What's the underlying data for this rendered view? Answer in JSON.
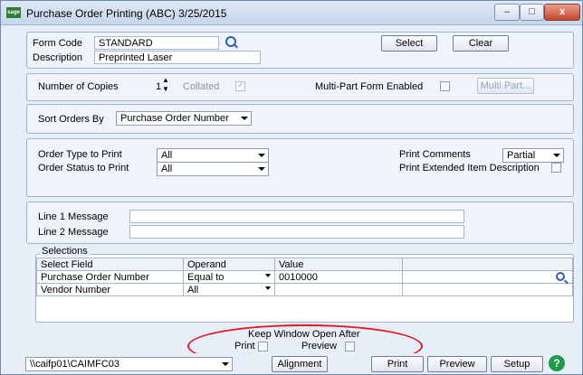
{
  "window": {
    "title": "Purchase Order Printing (ABC) 3/25/2015",
    "app_icon": "sage",
    "minimize_glyph": "–",
    "maximize_glyph": "□",
    "close_glyph": "x"
  },
  "form": {
    "form_code_label": "Form Code",
    "form_code_value": "STANDARD",
    "description_label": "Description",
    "description_value": "Preprinted Laser",
    "select_button": "Select",
    "clear_button": "Clear"
  },
  "copies": {
    "label": "Number of Copies",
    "value": "1",
    "collated_label": "Collated",
    "collated_checked": true,
    "multipart_label": "Multi-Part Form Enabled",
    "multipart_checked": false,
    "multipart_button": "Multi Part..."
  },
  "sort": {
    "label": "Sort Orders By",
    "value": "Purchase Order Number"
  },
  "options": {
    "order_type_label": "Order Type to Print",
    "order_type_value": "All",
    "order_status_label": "Order Status to Print",
    "order_status_value": "All",
    "print_comments_label": "Print Comments",
    "print_comments_value": "Partial",
    "print_ext_desc_label": "Print Extended Item Description",
    "print_ext_desc_checked": false
  },
  "messages": {
    "line1_label": "Line 1 Message",
    "line1_value": "",
    "line2_label": "Line 2 Message",
    "line2_value": ""
  },
  "selections": {
    "title": "Selections",
    "headers": [
      "Select Field",
      "Operand",
      "Value",
      ""
    ],
    "rows": [
      {
        "field": "Purchase Order Number",
        "operand": "Equal to",
        "value": "0010000",
        "extra": ""
      },
      {
        "field": "Vendor Number",
        "operand": "All",
        "value": "",
        "extra": ""
      }
    ]
  },
  "keep_open": {
    "label": "Keep Window Open After",
    "print_label": "Print",
    "print_checked": false,
    "preview_label": "Preview",
    "preview_checked": false
  },
  "bottom": {
    "printer_value": "\\\\caifp01\\CAIMFC03",
    "alignment_button": "Alignment",
    "print_button": "Print",
    "preview_button": "Preview",
    "setup_button": "Setup",
    "help_glyph": "?"
  },
  "colors": {
    "highlight_oval": "#e0171f",
    "help_button": "#1f9a4a"
  }
}
